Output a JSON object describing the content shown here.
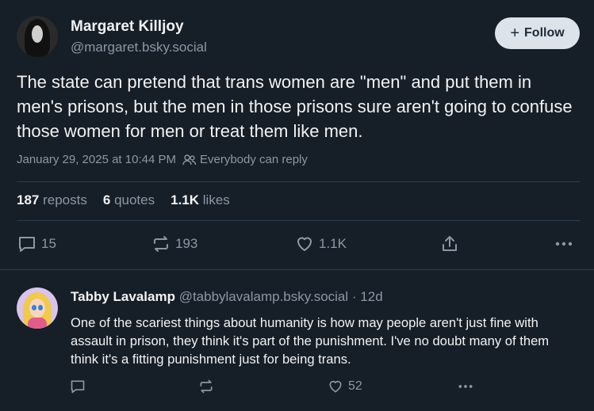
{
  "post": {
    "author_name": "Margaret Killjoy",
    "author_handle": "@margaret.bsky.social",
    "follow_label": "Follow",
    "text": "The state can pretend that trans women are \"men\" and put them in men's prisons, but the men in those prisons sure aren't going to confuse those women for men or treat them like men.",
    "timestamp": "January 29, 2025 at 10:44 PM",
    "reply_setting": "Everybody can reply",
    "stats": {
      "reposts_count": "187",
      "reposts_label": "reposts",
      "quotes_count": "6",
      "quotes_label": "quotes",
      "likes_count": "1.1K",
      "likes_label": "likes"
    },
    "actions": {
      "replies": "15",
      "reposts": "193",
      "likes": "1.1K"
    }
  },
  "reply": {
    "author_name": "Tabby Lavalamp",
    "author_handle": "@tabbylavalamp.bsky.social",
    "age": "· 12d",
    "text": "One of the scariest things about humanity is how may people aren't just fine with assault in prison, they think it's part of the punishment. I've no doubt many of them think it's a fitting punishment just for being trans.",
    "likes": "52"
  },
  "icons": {
    "reply": "speech-bubble-icon",
    "repost": "repost-arrows-icon",
    "like": "heart-icon",
    "share": "share-icon",
    "more": "ellipsis-icon",
    "people": "people-icon"
  }
}
